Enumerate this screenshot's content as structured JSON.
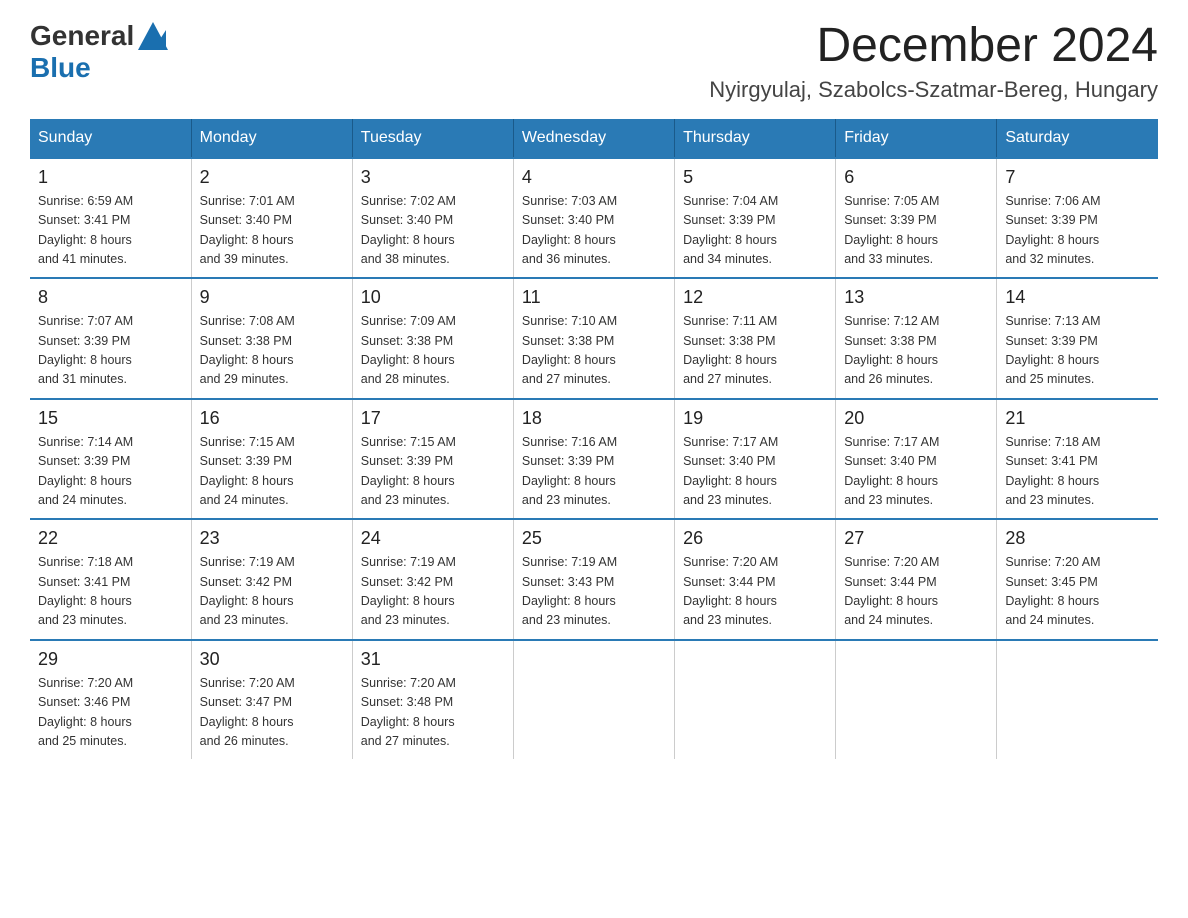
{
  "header": {
    "logo_general": "General",
    "logo_blue": "Blue",
    "month_year": "December 2024",
    "location": "Nyirgyulaj, Szabolcs-Szatmar-Bereg, Hungary"
  },
  "days_of_week": [
    "Sunday",
    "Monday",
    "Tuesday",
    "Wednesday",
    "Thursday",
    "Friday",
    "Saturday"
  ],
  "weeks": [
    [
      {
        "day": "1",
        "sunrise": "6:59 AM",
        "sunset": "3:41 PM",
        "daylight": "8 hours and 41 minutes."
      },
      {
        "day": "2",
        "sunrise": "7:01 AM",
        "sunset": "3:40 PM",
        "daylight": "8 hours and 39 minutes."
      },
      {
        "day": "3",
        "sunrise": "7:02 AM",
        "sunset": "3:40 PM",
        "daylight": "8 hours and 38 minutes."
      },
      {
        "day": "4",
        "sunrise": "7:03 AM",
        "sunset": "3:40 PM",
        "daylight": "8 hours and 36 minutes."
      },
      {
        "day": "5",
        "sunrise": "7:04 AM",
        "sunset": "3:39 PM",
        "daylight": "8 hours and 34 minutes."
      },
      {
        "day": "6",
        "sunrise": "7:05 AM",
        "sunset": "3:39 PM",
        "daylight": "8 hours and 33 minutes."
      },
      {
        "day": "7",
        "sunrise": "7:06 AM",
        "sunset": "3:39 PM",
        "daylight": "8 hours and 32 minutes."
      }
    ],
    [
      {
        "day": "8",
        "sunrise": "7:07 AM",
        "sunset": "3:39 PM",
        "daylight": "8 hours and 31 minutes."
      },
      {
        "day": "9",
        "sunrise": "7:08 AM",
        "sunset": "3:38 PM",
        "daylight": "8 hours and 29 minutes."
      },
      {
        "day": "10",
        "sunrise": "7:09 AM",
        "sunset": "3:38 PM",
        "daylight": "8 hours and 28 minutes."
      },
      {
        "day": "11",
        "sunrise": "7:10 AM",
        "sunset": "3:38 PM",
        "daylight": "8 hours and 27 minutes."
      },
      {
        "day": "12",
        "sunrise": "7:11 AM",
        "sunset": "3:38 PM",
        "daylight": "8 hours and 27 minutes."
      },
      {
        "day": "13",
        "sunrise": "7:12 AM",
        "sunset": "3:38 PM",
        "daylight": "8 hours and 26 minutes."
      },
      {
        "day": "14",
        "sunrise": "7:13 AM",
        "sunset": "3:39 PM",
        "daylight": "8 hours and 25 minutes."
      }
    ],
    [
      {
        "day": "15",
        "sunrise": "7:14 AM",
        "sunset": "3:39 PM",
        "daylight": "8 hours and 24 minutes."
      },
      {
        "day": "16",
        "sunrise": "7:15 AM",
        "sunset": "3:39 PM",
        "daylight": "8 hours and 24 minutes."
      },
      {
        "day": "17",
        "sunrise": "7:15 AM",
        "sunset": "3:39 PM",
        "daylight": "8 hours and 23 minutes."
      },
      {
        "day": "18",
        "sunrise": "7:16 AM",
        "sunset": "3:39 PM",
        "daylight": "8 hours and 23 minutes."
      },
      {
        "day": "19",
        "sunrise": "7:17 AM",
        "sunset": "3:40 PM",
        "daylight": "8 hours and 23 minutes."
      },
      {
        "day": "20",
        "sunrise": "7:17 AM",
        "sunset": "3:40 PM",
        "daylight": "8 hours and 23 minutes."
      },
      {
        "day": "21",
        "sunrise": "7:18 AM",
        "sunset": "3:41 PM",
        "daylight": "8 hours and 23 minutes."
      }
    ],
    [
      {
        "day": "22",
        "sunrise": "7:18 AM",
        "sunset": "3:41 PM",
        "daylight": "8 hours and 23 minutes."
      },
      {
        "day": "23",
        "sunrise": "7:19 AM",
        "sunset": "3:42 PM",
        "daylight": "8 hours and 23 minutes."
      },
      {
        "day": "24",
        "sunrise": "7:19 AM",
        "sunset": "3:42 PM",
        "daylight": "8 hours and 23 minutes."
      },
      {
        "day": "25",
        "sunrise": "7:19 AM",
        "sunset": "3:43 PM",
        "daylight": "8 hours and 23 minutes."
      },
      {
        "day": "26",
        "sunrise": "7:20 AM",
        "sunset": "3:44 PM",
        "daylight": "8 hours and 23 minutes."
      },
      {
        "day": "27",
        "sunrise": "7:20 AM",
        "sunset": "3:44 PM",
        "daylight": "8 hours and 24 minutes."
      },
      {
        "day": "28",
        "sunrise": "7:20 AM",
        "sunset": "3:45 PM",
        "daylight": "8 hours and 24 minutes."
      }
    ],
    [
      {
        "day": "29",
        "sunrise": "7:20 AM",
        "sunset": "3:46 PM",
        "daylight": "8 hours and 25 minutes."
      },
      {
        "day": "30",
        "sunrise": "7:20 AM",
        "sunset": "3:47 PM",
        "daylight": "8 hours and 26 minutes."
      },
      {
        "day": "31",
        "sunrise": "7:20 AM",
        "sunset": "3:48 PM",
        "daylight": "8 hours and 27 minutes."
      },
      null,
      null,
      null,
      null
    ]
  ],
  "labels": {
    "sunrise": "Sunrise:",
    "sunset": "Sunset:",
    "daylight": "Daylight:"
  }
}
